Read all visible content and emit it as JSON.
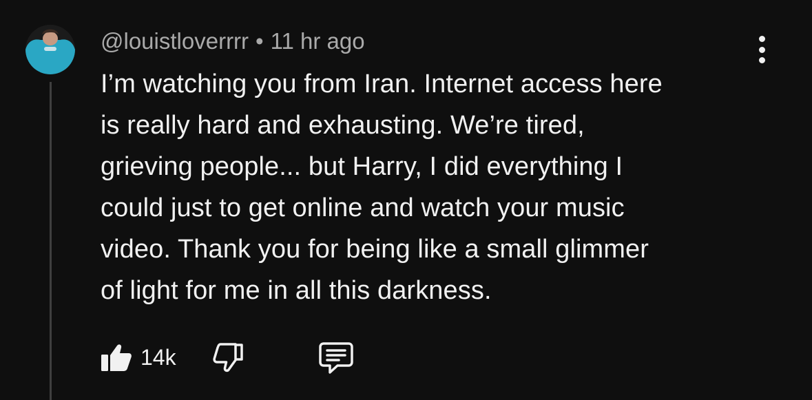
{
  "comment": {
    "author": "@louistloverrrr",
    "separator": "•",
    "time_ago": "11 hr ago",
    "body_lines": [
      "I’m watching you from Iran. Internet access here",
      "is really hard and exhausting. We’re tired,",
      "grieving people... but Harry, I did everything I",
      "could just to get online and watch your music",
      "video. Thank you for being like a small glimmer",
      "of light for me in all this darkness."
    ],
    "like_count": "14k",
    "icons": {
      "like": "thumbs-up-icon",
      "dislike": "thumbs-down-icon",
      "reply": "reply-comment-icon",
      "menu": "more-vertical-icon"
    }
  },
  "colors": {
    "background": "#0f0f0f",
    "text_primary": "#f1f1f1",
    "text_secondary": "#aaaaaa",
    "avatar_accent": "#2aa7c4"
  }
}
